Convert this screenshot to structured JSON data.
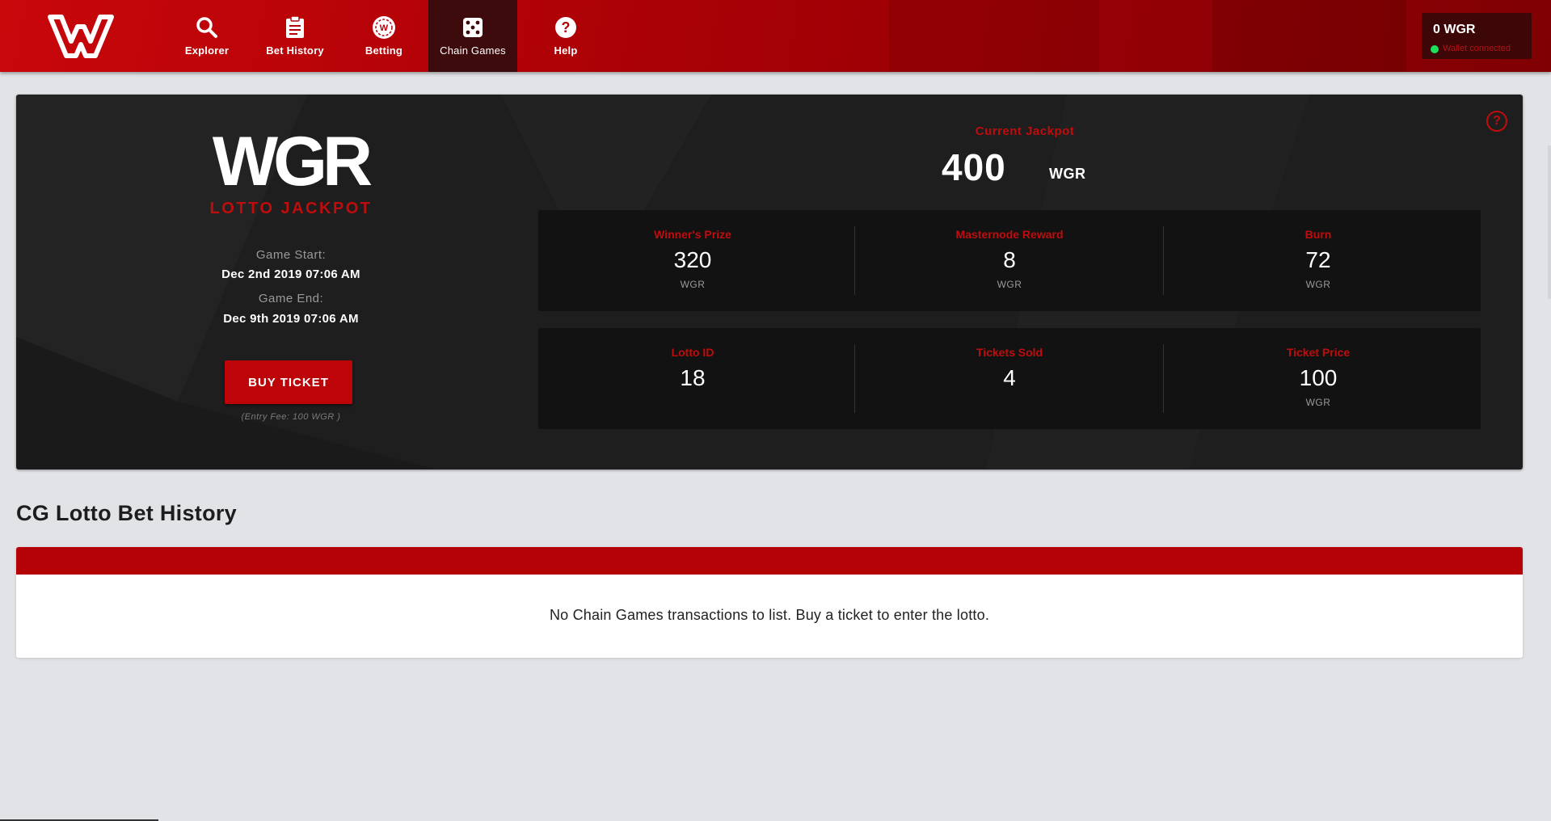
{
  "nav": {
    "items": [
      {
        "label": "Explorer",
        "icon": "search-icon"
      },
      {
        "label": "Bet History",
        "icon": "clipboard-icon"
      },
      {
        "label": "Betting",
        "icon": "wgr-chip-icon"
      },
      {
        "label": "Chain Games",
        "icon": "dice-icon",
        "active": true
      },
      {
        "label": "Help",
        "icon": "question-icon"
      }
    ]
  },
  "wallet": {
    "balance": "0 WGR",
    "status": "Wallet connected",
    "status_color": "#1be05a"
  },
  "lotto": {
    "logo_text": "WGR",
    "title": "LOTTO JACKPOT",
    "game_start_label": "Game Start:",
    "game_start": "Dec 2nd 2019 07:06 AM",
    "game_end_label": "Game End:",
    "game_end": "Dec 9th 2019 07:06 AM",
    "buy_button": "BUY TICKET",
    "entry_fee": "(Entry Fee: 100 WGR )",
    "current_jackpot_label": "Current Jackpot",
    "current_jackpot": "400",
    "currency": "WGR",
    "prizes": [
      {
        "label": "Winner's Prize",
        "value": "320",
        "unit": "WGR"
      },
      {
        "label": "Masternode Reward",
        "value": "8",
        "unit": "WGR"
      },
      {
        "label": "Burn",
        "value": "72",
        "unit": "WGR"
      }
    ],
    "details": [
      {
        "label": "Lotto ID",
        "value": "18",
        "unit": ""
      },
      {
        "label": "Tickets Sold",
        "value": "4",
        "unit": ""
      },
      {
        "label": "Ticket Price",
        "value": "100",
        "unit": "WGR"
      }
    ]
  },
  "history": {
    "title": "CG Lotto Bet History",
    "empty_message": "No Chain Games transactions to list. Buy a ticket to enter the lotto."
  },
  "colors": {
    "brand_red": "#bd0409",
    "panel_bg": "#1e1e1f",
    "page_bg": "#e1e3e7"
  }
}
